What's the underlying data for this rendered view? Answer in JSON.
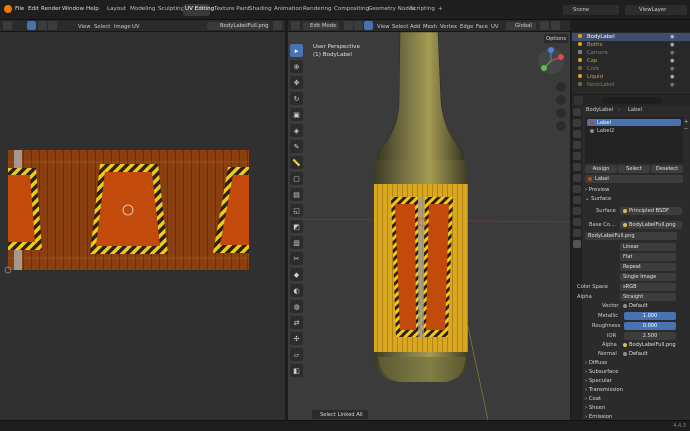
{
  "menu": [
    "File",
    "Edit",
    "Render",
    "Window",
    "Help"
  ],
  "workspaces": [
    "Layout",
    "Modeling",
    "Sculpting",
    "UV Editing",
    "Texture Paint",
    "Shading",
    "Animation",
    "Rendering",
    "Compositing",
    "Geometry Nodes",
    "Scripting"
  ],
  "scene_name": "Scene",
  "view_layer": "ViewLayer",
  "uv_header": {
    "items": [
      "View",
      "Select",
      "Image",
      "UV"
    ],
    "image_name": "BodyLabelFull.png"
  },
  "viewport_header": {
    "mode": "Edit Mode",
    "items": [
      "View",
      "Select",
      "Add",
      "Mesh",
      "Vertex",
      "Edge",
      "Face",
      "UV"
    ],
    "orientation": "Global",
    "options": "Options"
  },
  "viewport_overlay": {
    "line1": "User Perspective",
    "line2": "(1) BodyLabel"
  },
  "outliner": [
    {
      "name": "BodyLabel",
      "active": true
    },
    {
      "name": "Bottle",
      "active": false
    },
    {
      "name": "Camera",
      "active": false
    },
    {
      "name": "Cap",
      "active": false
    },
    {
      "name": "Cork",
      "active": false
    },
    {
      "name": "Liquid",
      "active": false
    },
    {
      "name": "NeckLabel",
      "active": false
    }
  ],
  "properties": {
    "breadcrumb_object": "BodyLabel",
    "breadcrumb_material": "Label",
    "slots": [
      "Label",
      "Label2"
    ],
    "assign": "Assign",
    "select": "Select",
    "deselect": "Deselect",
    "material_name": "Label",
    "preview": "Preview",
    "surface_header": "Surface",
    "surface_label": "Surface",
    "surface_value": "Principled BSDF",
    "base_color_label": "Base Co...",
    "base_color_value": "BodyLabelFull.png",
    "image_name": "BodyLabelFull.png",
    "interpolation": "Linear",
    "projection": "Flat",
    "extension": "Repeat",
    "source": "Single Image",
    "color_space_label": "Color Space",
    "color_space": "sRGB",
    "alpha_label": "Alpha",
    "alpha_mode": "Straight",
    "vector_label": "Vector",
    "vector_value": "Default",
    "metallic_label": "Metallic",
    "metallic_value": "1.000",
    "roughness_label": "Roughness",
    "roughness_value": "0.000",
    "ior_label": "IOR",
    "ior_value": "2.500",
    "alpha_input_label": "Alpha",
    "alpha_input_value": "BodyLabelFull.png",
    "normal_label": "Normal",
    "normal_value": "Default",
    "sections": [
      "Diffuse",
      "Subsurface",
      "Specular",
      "Transmission",
      "Coat",
      "Sheen",
      "Emission"
    ]
  },
  "status": {
    "left": "Select Linked All",
    "version": "4.4.3"
  },
  "colors": {
    "accent": "#4772b3",
    "wood": "#8a3f10",
    "label_orange": "#c24a0b",
    "stripe_yellow": "#f2c81a",
    "bottle_yellow": "#d8a820"
  }
}
